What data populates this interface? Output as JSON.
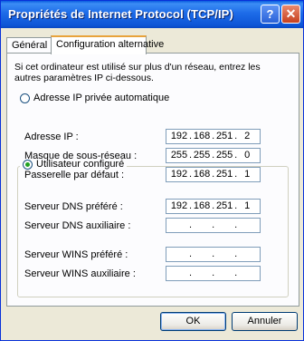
{
  "window": {
    "title": "Propriétés de Internet Protocol (TCP/IP)",
    "help": "?",
    "close": "✕"
  },
  "tabs": [
    "Général",
    "Configuration alternative"
  ],
  "description": "Si cet ordinateur est utilisé sur plus d'un réseau, entrez les autres paramètres IP ci-dessous.",
  "options": {
    "auto": {
      "label": "Adresse IP privée automatique",
      "selected": false
    },
    "manual": {
      "label": "Utilisateur configuré",
      "selected": true
    }
  },
  "fields": [
    {
      "label": "Adresse IP :",
      "octets": [
        "192",
        "168",
        "251",
        "2"
      ]
    },
    {
      "label": "Masque de sous-réseau :",
      "octets": [
        "255",
        "255",
        "255",
        "0"
      ]
    },
    {
      "label": "Passerelle par défaut :",
      "octets": [
        "192",
        "168",
        "251",
        "1"
      ]
    },
    {
      "label": "Serveur DNS préféré :",
      "octets": [
        "192",
        "168",
        "251",
        "1"
      ]
    },
    {
      "label": "Serveur DNS auxiliaire :",
      "octets": [
        "",
        "",
        "",
        ""
      ]
    },
    {
      "label": "Serveur WINS préféré :",
      "octets": [
        "",
        "",
        "",
        ""
      ]
    },
    {
      "label": "Serveur WINS auxiliaire :",
      "octets": [
        "",
        "",
        "",
        ""
      ]
    }
  ],
  "buttons": {
    "ok": "OK",
    "cancel": "Annuler"
  }
}
